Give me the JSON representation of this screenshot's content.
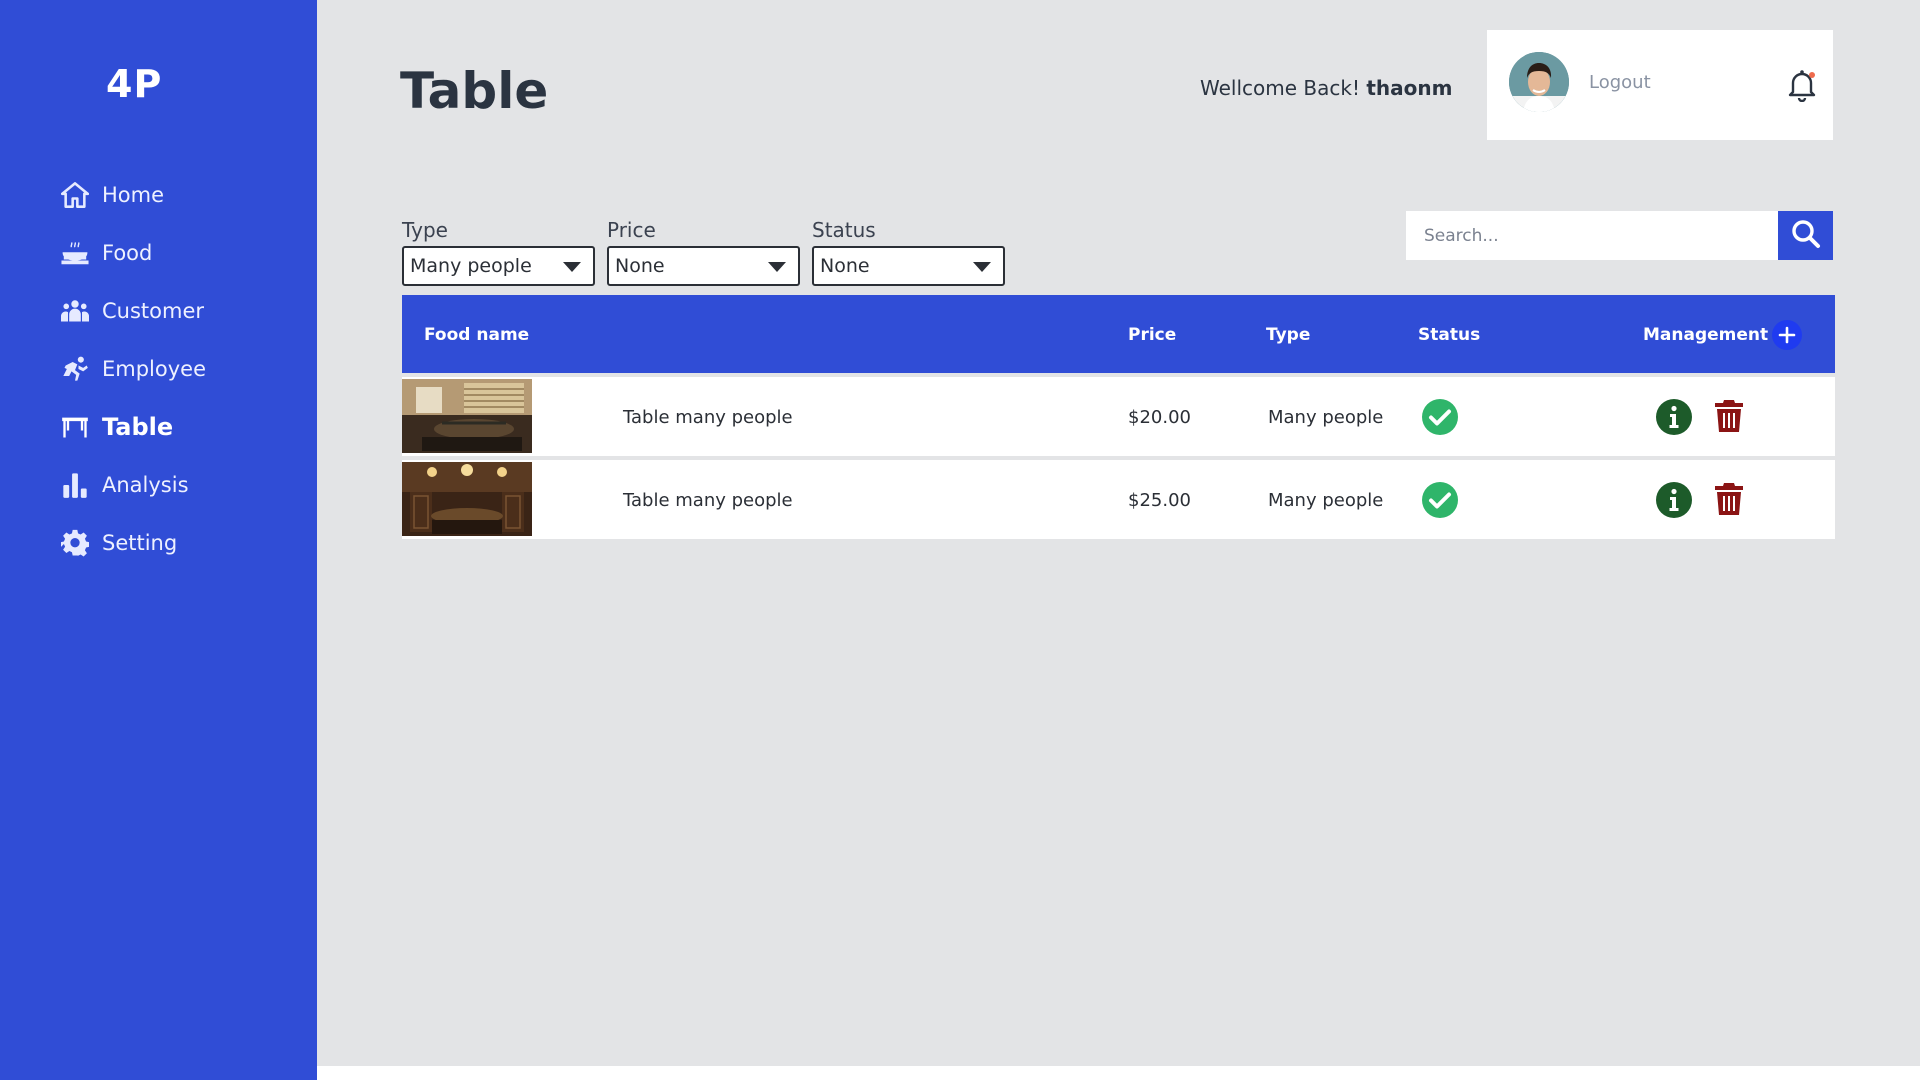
{
  "app": {
    "logo": "4P"
  },
  "sidebar": {
    "items": [
      {
        "label": "Home",
        "icon": "home-icon",
        "active": false
      },
      {
        "label": "Food",
        "icon": "food-icon",
        "active": false
      },
      {
        "label": "Customer",
        "icon": "customer-icon",
        "active": false
      },
      {
        "label": "Employee",
        "icon": "employee-icon",
        "active": false
      },
      {
        "label": "Table",
        "icon": "table-icon",
        "active": true
      },
      {
        "label": "Analysis",
        "icon": "analysis-icon",
        "active": false
      },
      {
        "label": "Setting",
        "icon": "gear-icon",
        "active": false
      }
    ]
  },
  "header": {
    "title": "Table",
    "welcome_prefix": "Wellcome Back!",
    "username": "thaonm",
    "logout_label": "Logout"
  },
  "filters": {
    "type": {
      "label": "Type",
      "value": "Many people"
    },
    "price": {
      "label": "Price",
      "value": "None"
    },
    "status": {
      "label": "Status",
      "value": "None"
    }
  },
  "search": {
    "placeholder": "Search..."
  },
  "table": {
    "columns": {
      "name": "Food name",
      "price": "Price",
      "type": "Type",
      "status": "Status",
      "management": "Management"
    },
    "rows": [
      {
        "name": "Table many people",
        "price": "$20.00",
        "type": "Many people"
      },
      {
        "name": "Table many people",
        "price": "$25.00",
        "type": "Many people"
      }
    ]
  },
  "colors": {
    "sidebar": "#304dd6",
    "background": "#e3e4e6",
    "status_ok": "#2fb56a",
    "info": "#1d5b2a",
    "delete": "#8b1414"
  }
}
